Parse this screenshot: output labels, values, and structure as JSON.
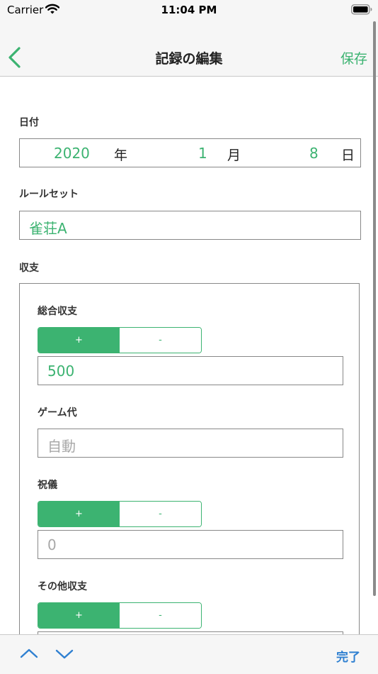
{
  "status_bar": {
    "carrier": "Carrier",
    "time": "11:04 PM",
    "icons": [
      "wifi-icon",
      "battery-icon"
    ]
  },
  "nav": {
    "title": "記録の編集",
    "save_label": "保存",
    "back_icon": "chevron-left-icon"
  },
  "date": {
    "label": "日付",
    "year": "2020",
    "year_unit": "年",
    "month": "1",
    "month_unit": "月",
    "day": "8",
    "day_unit": "日"
  },
  "ruleset": {
    "label": "ルールセット",
    "value": "雀荘A"
  },
  "income": {
    "label": "収支",
    "total": {
      "label": "総合収支",
      "plus": "+",
      "minus": "-",
      "selected": "+",
      "value": "500"
    },
    "game_fee": {
      "label": "ゲーム代",
      "placeholder": "自動"
    },
    "tip": {
      "label": "祝儀",
      "plus": "+",
      "minus": "-",
      "selected": "+",
      "placeholder": "0"
    },
    "other": {
      "label": "その他収支",
      "plus": "+",
      "minus": "-",
      "selected": "+"
    }
  },
  "toolbar": {
    "done_label": "完了",
    "icons": [
      "chevron-up-icon",
      "chevron-down-icon"
    ]
  },
  "colors": {
    "accent": "#3cb371",
    "done": "#2f80d1",
    "border": "#888888",
    "bar_bg": "#f6f6f6"
  }
}
